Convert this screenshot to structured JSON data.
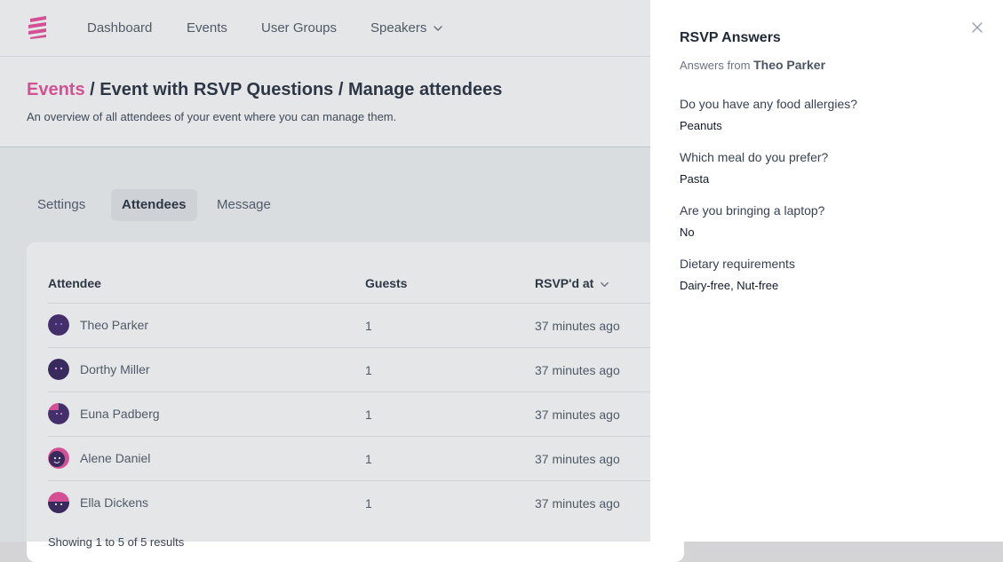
{
  "nav": {
    "items": [
      {
        "label": "Dashboard"
      },
      {
        "label": "Events"
      },
      {
        "label": "User Groups"
      },
      {
        "label": "Speakers"
      }
    ]
  },
  "header": {
    "breadcrumb_link": "Events",
    "breadcrumb_rest": " / Event with RSVP Questions / Manage attendees",
    "subtitle": "An overview of all attendees of your event where you can manage them."
  },
  "tabs": [
    {
      "label": "Settings"
    },
    {
      "label": "Attendees"
    },
    {
      "label": "Message"
    }
  ],
  "table": {
    "columns": [
      "Attendee",
      "Guests",
      "RSVP'd at"
    ],
    "rows": [
      {
        "name": "Theo Parker",
        "guests": "1",
        "rsvp": "37 minutes ago"
      },
      {
        "name": "Dorthy Miller",
        "guests": "1",
        "rsvp": "37 minutes ago"
      },
      {
        "name": "Euna Padberg",
        "guests": "1",
        "rsvp": "37 minutes ago"
      },
      {
        "name": "Alene Daniel",
        "guests": "1",
        "rsvp": "37 minutes ago"
      },
      {
        "name": "Ella Dickens",
        "guests": "1",
        "rsvp": "37 minutes ago"
      }
    ],
    "pagination": "Showing 1 to 5 of 5 results"
  },
  "panel": {
    "title": "RSVP Answers",
    "answers_from_label": "Answers from",
    "answers_from_name": "Theo Parker",
    "qa": [
      {
        "question": "Do you have any food allergies?",
        "answer": "Peanuts"
      },
      {
        "question": "Which meal do you prefer?",
        "answer": "Pasta"
      },
      {
        "question": "Are you bringing a laptop?",
        "answer": "No"
      },
      {
        "question": "Dietary requirements",
        "answer": "Dairy-free, Nut-free"
      }
    ]
  },
  "colors": {
    "accent": "#ec4899",
    "avatar_dark": "#3b2266",
    "avatar_pink": "#ec4899"
  },
  "icons": {
    "logo": "logo-icon",
    "nav_dropdown": "chevron-down-icon",
    "sort": "chevron-down-icon",
    "close": "close-icon",
    "avatar": "avatar-face-icon"
  }
}
